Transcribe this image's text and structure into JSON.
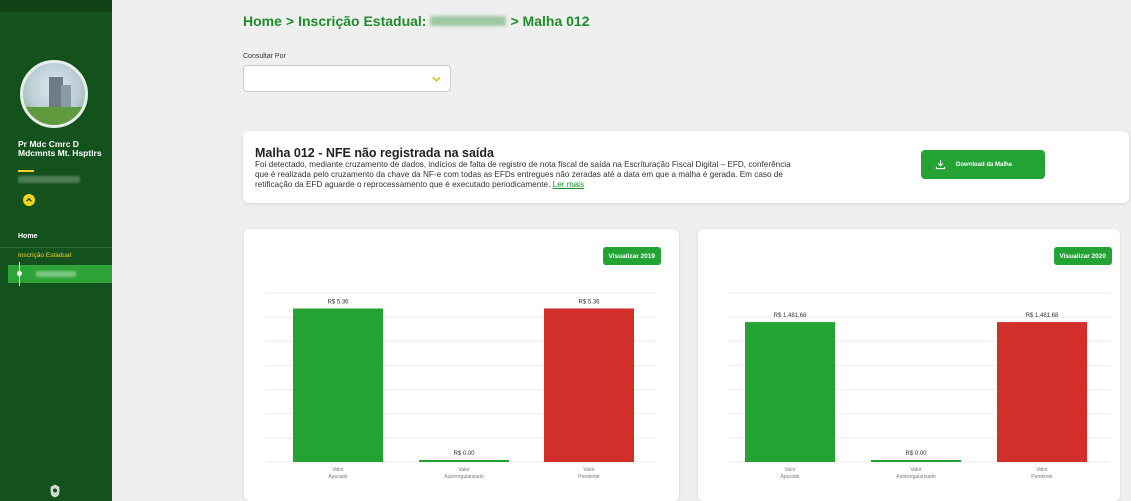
{
  "sidebar": {
    "user_name": "Pr Mdc Cmrc D Mdcmnts Mt. Hsptlrs",
    "nav": {
      "home_label": "Home",
      "inscricao_label": "Inscrição Estadual"
    }
  },
  "header": {
    "breadcrumb_home": "Home",
    "breadcrumb_sep1": ">",
    "breadcrumb_ie": "Inscrição Estadual:",
    "breadcrumb_sep2": "> Malha 012"
  },
  "filter": {
    "label": "Consultar Por",
    "value": ""
  },
  "info": {
    "title": "Malha 012 - NFE não registrada na saída",
    "text": "Foi detectado, mediante cruzamento de dados, indícios de falta de registro de nota fiscal de saída na Escrituração Fiscal Digital – EFD, conferência que é realizada pelo cruzamento da chave da NF-e com todas as EFDs entregues não zeradas até a data em que a malha é gerada. Em caso de retificação da EFD aguarde o reprocessamento que é executado periodicamente.",
    "link_label": "Ler mais",
    "download_label": "Download da Malha"
  },
  "colors": {
    "sidebar": "#14521d",
    "accent": "#22a334",
    "pending": "#d32f2a",
    "highlight": "#f4d21f"
  },
  "chart_data": [
    {
      "type": "bar",
      "button_label": "Visualizar 2019",
      "categories": [
        [
          "Valor",
          "Apurado"
        ],
        [
          "Valor",
          "Autorregularizado"
        ],
        [
          "Valor",
          "Pendente"
        ]
      ],
      "values": [
        5.36,
        0.0,
        5.36
      ],
      "labels": [
        "R$ 5.36",
        "R$ 0.00",
        "R$ 5.36"
      ],
      "colors": [
        "#22a334",
        "#22a334",
        "#d32f2a"
      ],
      "ylim": [
        0,
        5.9
      ]
    },
    {
      "type": "bar",
      "button_label": "Visualizar 2020",
      "categories": [
        [
          "Valor",
          "Apurado"
        ],
        [
          "Valor",
          "Autorregularizado"
        ],
        [
          "Valor",
          "Pendente"
        ]
      ],
      "values": [
        1481.68,
        0.0,
        1481.68
      ],
      "labels": [
        "R$ 1.481.68",
        "R$ 0.00",
        "R$ 1.481.68"
      ],
      "colors": [
        "#22a334",
        "#22a334",
        "#d32f2a"
      ],
      "ylim": [
        0,
        1790
      ]
    }
  ]
}
